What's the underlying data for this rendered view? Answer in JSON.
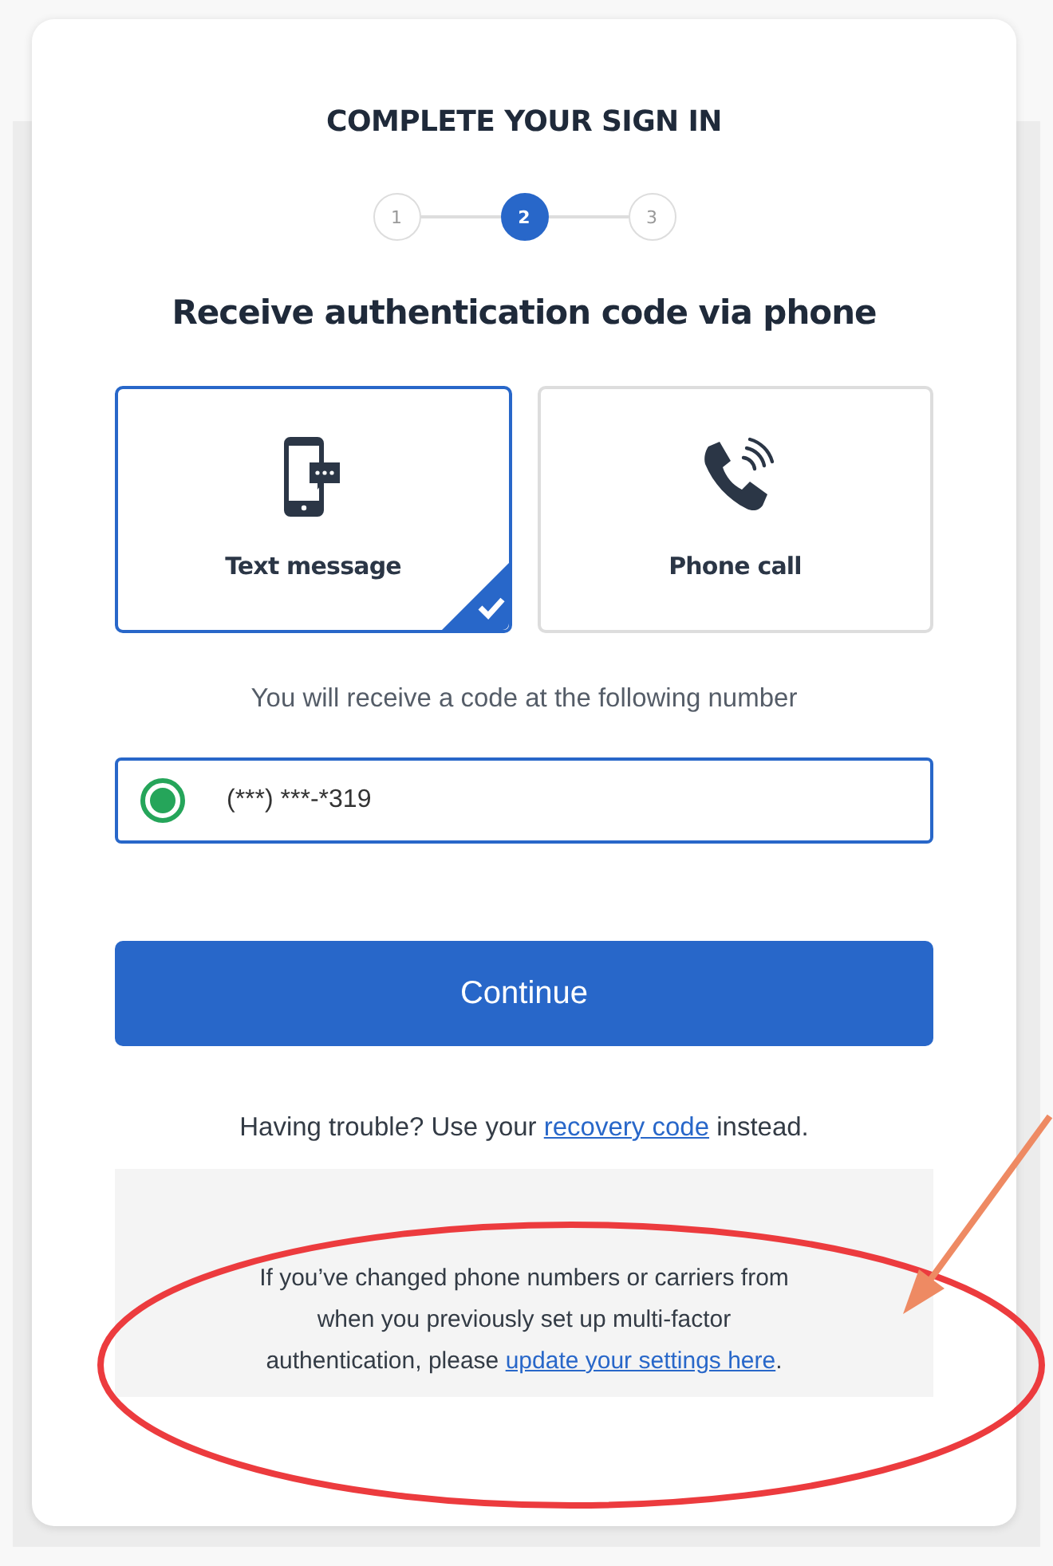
{
  "title": "COMPLETE YOUR SIGN IN",
  "steps": [
    {
      "label": "1",
      "selected": false
    },
    {
      "label": "2",
      "selected": true
    },
    {
      "label": "3",
      "selected": false
    }
  ],
  "heading": "Receive authentication code via phone",
  "options": [
    {
      "label": "Text message",
      "kind": "sms",
      "selected": true
    },
    {
      "label": "Phone call",
      "kind": "call",
      "selected": false
    }
  ],
  "hint": "You will receive a code at the following number",
  "phone_field": {
    "value": "(***) ***-*319",
    "checked": true
  },
  "continue_button": "Continue",
  "trouble": {
    "before": "Having trouble? Use your",
    "link": "recovery code",
    "after": "instead."
  },
  "notice": {
    "before": "If you’ve changed phone numbers or carriers from when you previously set up multi-factor authentication, please",
    "link": "update your settings here",
    "after": "."
  },
  "annotations": [
    {
      "kind": "ellipse"
    },
    {
      "kind": "arrow"
    }
  ]
}
